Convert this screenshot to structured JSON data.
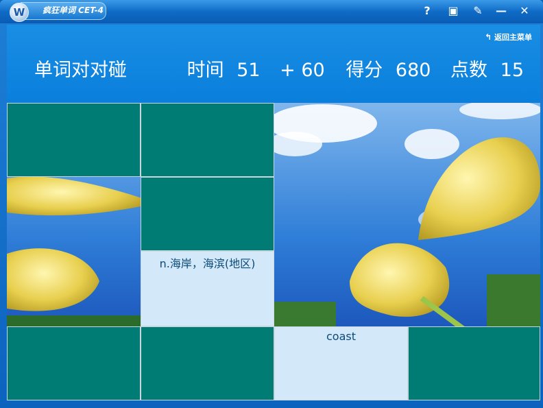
{
  "window": {
    "logo_letter": "W",
    "title": "疯狂单词 CET-4",
    "controls": [
      "?",
      "▣",
      "✎",
      "—",
      "✕"
    ]
  },
  "header": {
    "back_label": "返回主菜单",
    "game_title": "单词对对碰",
    "time_label": "时间",
    "time_value": "51",
    "bonus": "+ 60",
    "score_label": "得分",
    "score_value": "680",
    "points_label": "点数",
    "points_value": "15"
  },
  "board": {
    "revealed_cards": [
      {
        "text": "n.海岸，海滨(地区)"
      },
      {
        "text": "coast"
      }
    ]
  },
  "colors": {
    "card_back": "#007c74",
    "card_open": "#d3e8f8",
    "card_text": "#0c4a7a",
    "header_bg": "#0a7fdc"
  }
}
